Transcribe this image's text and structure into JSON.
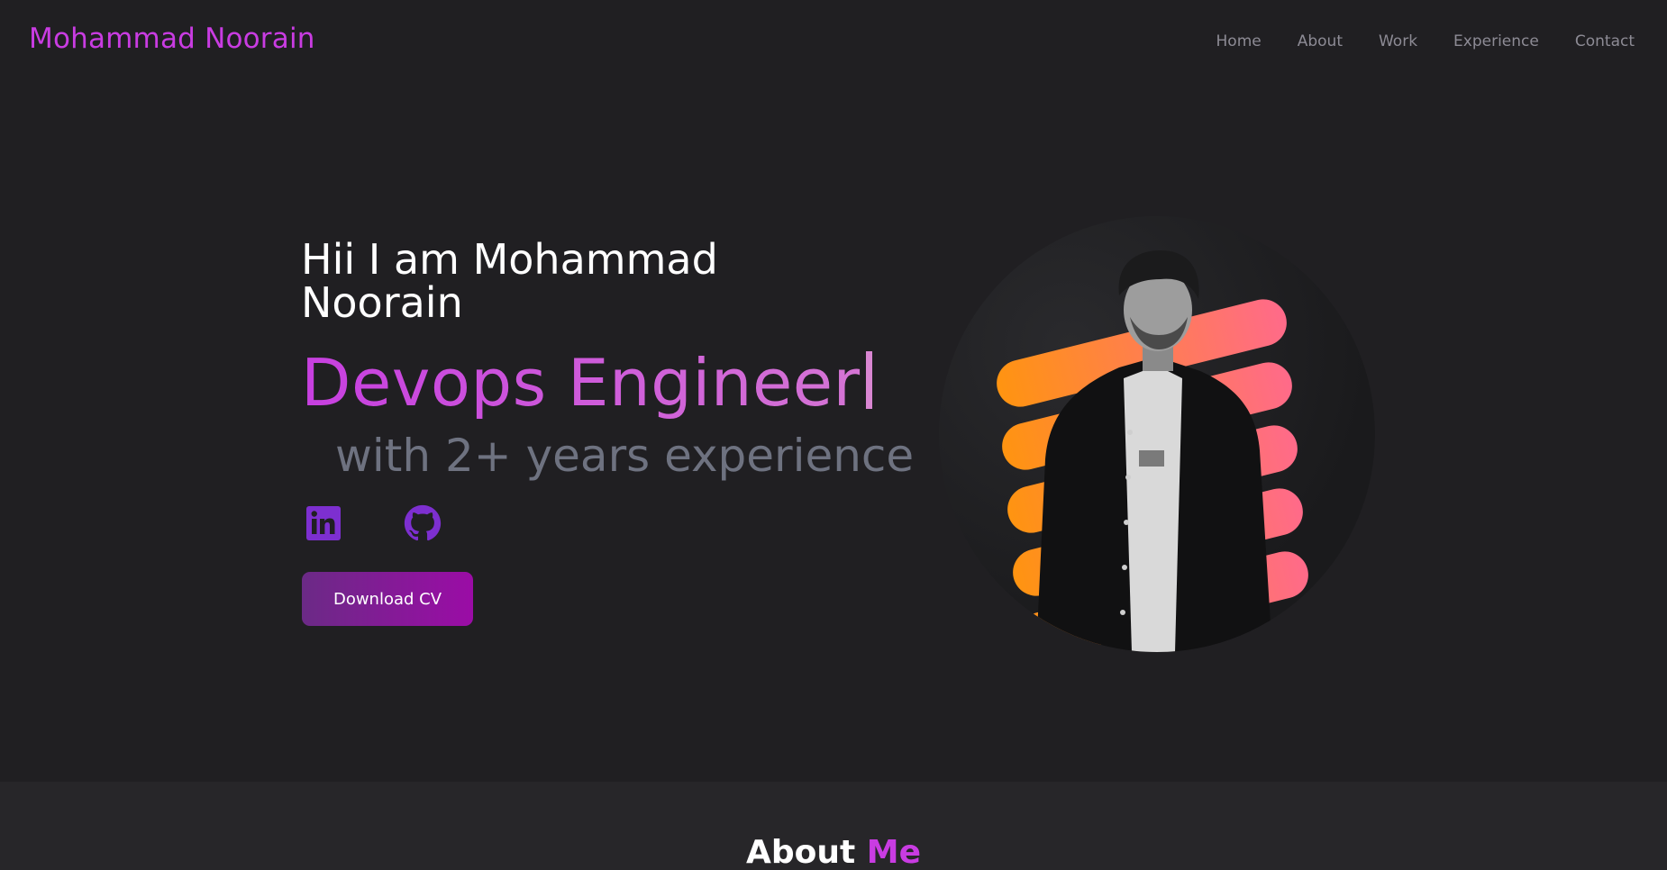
{
  "header": {
    "brand": "Mohammad Noorain",
    "nav": [
      "Home",
      "About",
      "Work",
      "Experience",
      "Contact"
    ]
  },
  "hero": {
    "greeting": "Hii I am Mohammad Noorain",
    "role": "Devops Engineer",
    "experience": "with 2+ years experience",
    "cta": "Download CV"
  },
  "socials": [
    {
      "icon": "linkedin-icon",
      "color": "#7d2fd0"
    },
    {
      "icon": "github-icon",
      "color": "#7d2fd0"
    }
  ],
  "about": {
    "title_start": "About",
    "title_accent": "Me"
  },
  "colors": {
    "background": "#201f22",
    "brand": "#c93ce2",
    "nav_text": "#8d8b95",
    "cta_from": "#6b2a86",
    "cta_to": "#9b0ca6"
  }
}
